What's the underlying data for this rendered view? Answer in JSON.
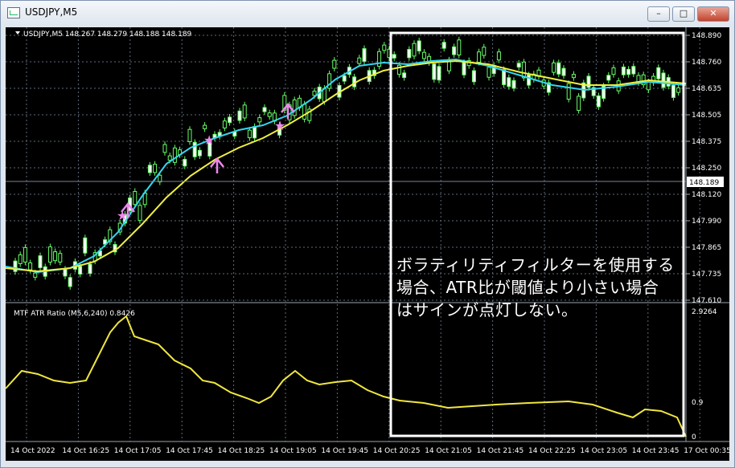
{
  "window": {
    "title": "USDJPY,M5",
    "buttons": [
      "minimize",
      "maximize",
      "close"
    ]
  },
  "main_panel": {
    "header": "USDJPY,M5  148.267 148.279 148.188 148.189",
    "price_levels": [
      "148.890",
      "148.760",
      "148.635",
      "148.505",
      "148.375",
      "148.250",
      "148.120",
      "147.990",
      "147.865",
      "147.735",
      "147.610"
    ],
    "current_price": "148.189"
  },
  "indicator_panel": {
    "header": "MTF ATR Ratio  (M5,6,240) 0.8426",
    "levels": [
      "2.9264",
      "0.9",
      "0"
    ]
  },
  "time_axis": [
    "14 Oct 2022",
    "14 Oct 16:25",
    "14 Oct 17:05",
    "14 Oct 17:45",
    "14 Oct 18:25",
    "14 Oct 19:05",
    "14 Oct 19:45",
    "14 Oct 20:25",
    "14 Oct 21:05",
    "14 Oct 21:45",
    "14 Oct 22:25",
    "14 Oct 23:05",
    "14 Oct 23:45",
    "17 Oct 00:35"
  ],
  "annotation": {
    "lines": [
      "ボラティリティフィルターを使用する",
      "場合、ATR比が閾値より小さい場合",
      "はサインが点灯しない。"
    ]
  },
  "colors": {
    "background": "#000000",
    "grid": "#5f6a77",
    "candle": "#66ff66",
    "fast_ma": "#33d6f0",
    "slow_ma": "#f0f040",
    "signal_arrow": "#ee88ee",
    "annotation_box": "#ffffff"
  },
  "chart_data": {
    "type": "candlestick",
    "price_range": [
      147.61,
      148.89
    ],
    "atr_range": [
      0,
      2.9264
    ],
    "icons": [
      "arrow-up-icon",
      "star-icon"
    ]
  }
}
